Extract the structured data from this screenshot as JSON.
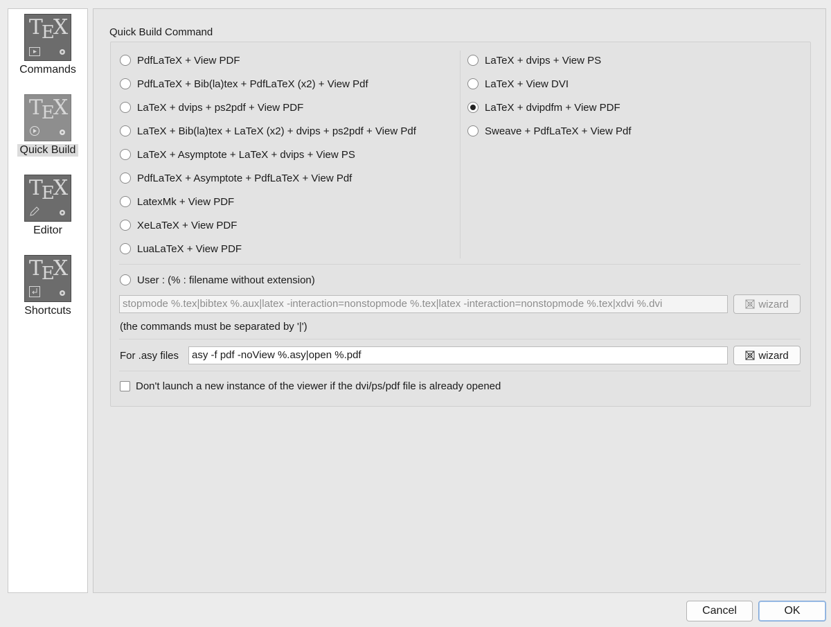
{
  "sidebar": {
    "items": [
      {
        "label": "Commands",
        "logo": "TEX",
        "icon": "terminal-icon"
      },
      {
        "label": "Quick Build",
        "logo": "TEX",
        "icon": "play-circle-icon",
        "selected": true
      },
      {
        "label": "Editor",
        "logo": "TEX",
        "icon": "pencil-icon"
      },
      {
        "label": "Shortcuts",
        "logo": "TEX",
        "icon": "return-key-icon"
      }
    ]
  },
  "quick_build": {
    "title": "Quick Build Command",
    "left_options": [
      "PdfLaTeX + View PDF",
      "PdfLaTeX + Bib(la)tex + PdfLaTeX (x2) + View Pdf",
      "LaTeX + dvips + ps2pdf + View PDF",
      "LaTeX + Bib(la)tex + LaTeX (x2) + dvips + ps2pdf + View Pdf",
      "LaTeX + Asymptote + LaTeX + dvips + View PS",
      "PdfLaTeX + Asymptote + PdfLaTeX + View Pdf",
      "LatexMk + View PDF",
      "XeLaTeX + View PDF",
      "LuaLaTeX + View PDF"
    ],
    "right_options": [
      "LaTeX + dvips + View PS",
      "LaTeX + View DVI",
      "LaTeX + dvipdfm + View PDF",
      "Sweave + PdfLaTeX + View Pdf"
    ],
    "selected": "LaTeX + dvipdfm + View PDF",
    "user_option": "User : (% : filename without extension)",
    "user_command": "stopmode %.tex|bibtex %.aux|latex -interaction=nonstopmode %.tex|latex -interaction=nonstopmode %.tex|xdvi %.dvi",
    "wizard_label": "wizard",
    "separator_note": "(the commands must be separated by '|')",
    "asy_label": "For .asy files",
    "asy_command": "asy -f pdf -noView %.asy|open %.pdf",
    "viewer_checkbox": "Don't launch a new instance of the viewer if the dvi/ps/pdf file is already opened",
    "viewer_checked": false
  },
  "footer": {
    "cancel": "Cancel",
    "ok": "OK"
  },
  "colors": {
    "window_bg": "#ececec",
    "icon_bg": "#6c6c6c",
    "icon_selected_bg": "#8e8e8e",
    "default_button_border": "#7fa7d8"
  }
}
